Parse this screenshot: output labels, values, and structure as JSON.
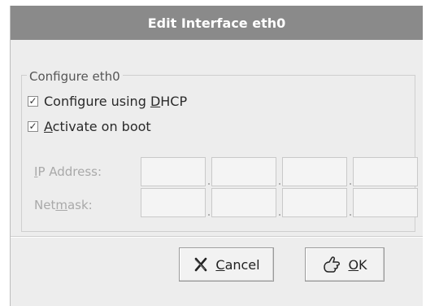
{
  "dialog": {
    "title": "Edit Interface eth0",
    "frame_label": "Configure eth0",
    "dhcp": {
      "pre": "Configure using ",
      "mnemonic": "D",
      "post": "HCP",
      "checked": true,
      "mark": "✓"
    },
    "boot": {
      "mnemonic": "A",
      "post": "ctivate on boot",
      "checked": true,
      "mark": "✓"
    },
    "ip_label": {
      "mnemonic": "I",
      "post": "P Address:"
    },
    "netmask_label": {
      "pre": "Net",
      "mnemonic": "m",
      "post": "ask:"
    },
    "buttons": {
      "cancel": {
        "mnemonic": "C",
        "post": "ancel",
        "icon": "cancel-x-icon"
      },
      "ok": {
        "mnemonic": "O",
        "post": "K",
        "icon": "ok-hand-icon"
      }
    }
  },
  "colors": {
    "titlebar": "#8a8a8a",
    "window_bg": "#ededed",
    "disabled_text": "#a9a9a9"
  }
}
